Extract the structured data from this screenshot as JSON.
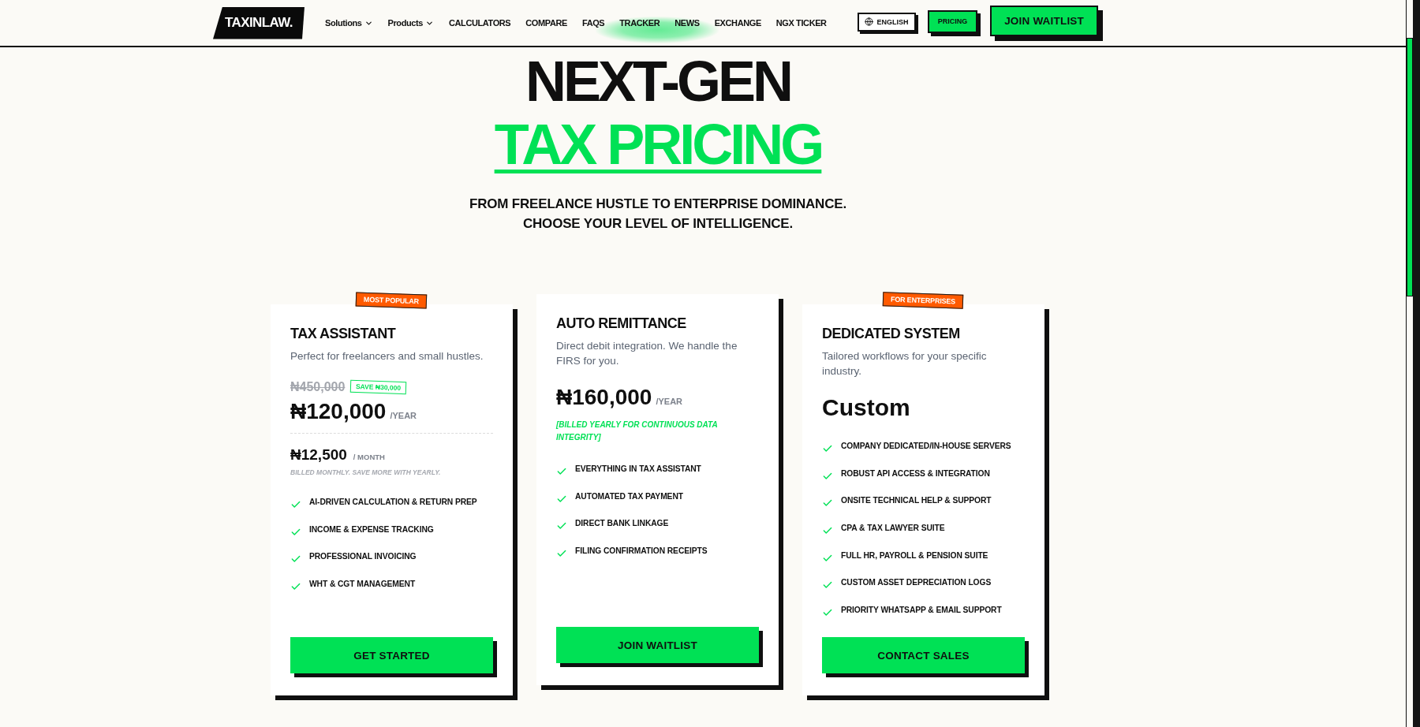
{
  "nav": {
    "logo": "TAXINLAW.",
    "links": [
      {
        "label": "Solutions",
        "dropdown": true
      },
      {
        "label": "Products",
        "dropdown": true
      },
      {
        "label": "CALCULATORS",
        "dropdown": false
      },
      {
        "label": "COMPARE",
        "dropdown": false
      },
      {
        "label": "FAQS",
        "dropdown": false
      },
      {
        "label": "TRACKER",
        "dropdown": false
      },
      {
        "label": "NEWS",
        "dropdown": false
      },
      {
        "label": "EXCHANGE",
        "dropdown": false
      },
      {
        "label": "NGX TICKER",
        "dropdown": false
      }
    ],
    "actions": [
      {
        "kind": "language",
        "label": "ENGLISH"
      },
      {
        "kind": "pill",
        "label": "PRICING"
      },
      {
        "kind": "cta",
        "label": "JOIN WAITLIST"
      }
    ]
  },
  "hero": {
    "title": "NEXT-GEN",
    "highlight": "TAX PRICING",
    "subtitle_lines": [
      "FROM FREELANCE HUSTLE TO ENTERPRISE DOMINANCE.",
      "CHOOSE YOUR LEVEL OF INTELLIGENCE."
    ]
  },
  "plans": [
    {
      "badge": "MOST POPULAR",
      "title": "TAX ASSISTANT",
      "description": "Perfect for freelancers and small hustles.",
      "pricing": {
        "kind": "discount",
        "old_price": "₦450,000",
        "save": "SAVE ₦30,000",
        "price": "₦120,000",
        "period": "/YEAR",
        "monthly_price": "₦12,500",
        "monthly_period": "/ MONTH",
        "note": "BILLED MONTHLY. SAVE MORE WITH YEARLY."
      },
      "features": [
        "AI-DRIVEN CALCULATION & RETURN PREP",
        "INCOME & EXPENSE TRACKING",
        "PROFESSIONAL INVOICING",
        "WHT & CGT MANAGEMENT"
      ],
      "button": "GET STARTED"
    },
    {
      "title": "AUTO REMITTANCE",
      "description": "Direct debit integration. We handle the FIRS for you.",
      "pricing": {
        "kind": "yearly",
        "price": "₦160,000",
        "period": "/YEAR",
        "note": "[BILLED YEARLY FOR CONTINUOUS DATA INTEGRITY]"
      },
      "features": [
        "EVERYTHING IN TAX ASSISTANT",
        "AUTOMATED TAX PAYMENT",
        "DIRECT BANK LINKAGE",
        "FILING CONFIRMATION RECEIPTS"
      ],
      "button": "JOIN WAITLIST"
    },
    {
      "badge": "FOR ENTERPRISES",
      "title": "DEDICATED SYSTEM",
      "description": "Tailored workflows for your specific industry.",
      "pricing": {
        "kind": "custom",
        "price": "Custom"
      },
      "features": [
        "COMPANY DEDICATED/IN-HOUSE SERVERS",
        "ROBUST API ACCESS & INTEGRATION",
        "ONSITE TECHNICAL HELP & SUPPORT",
        "CPA & TAX LAWYER SUITE",
        "FULL HR, PAYROLL & PENSION SUITE",
        "CUSTOM ASSET DEPRECIATION LOGS",
        "PRIORITY WHATSAPP & EMAIL SUPPORT"
      ],
      "button": "CONTACT SALES"
    }
  ]
}
